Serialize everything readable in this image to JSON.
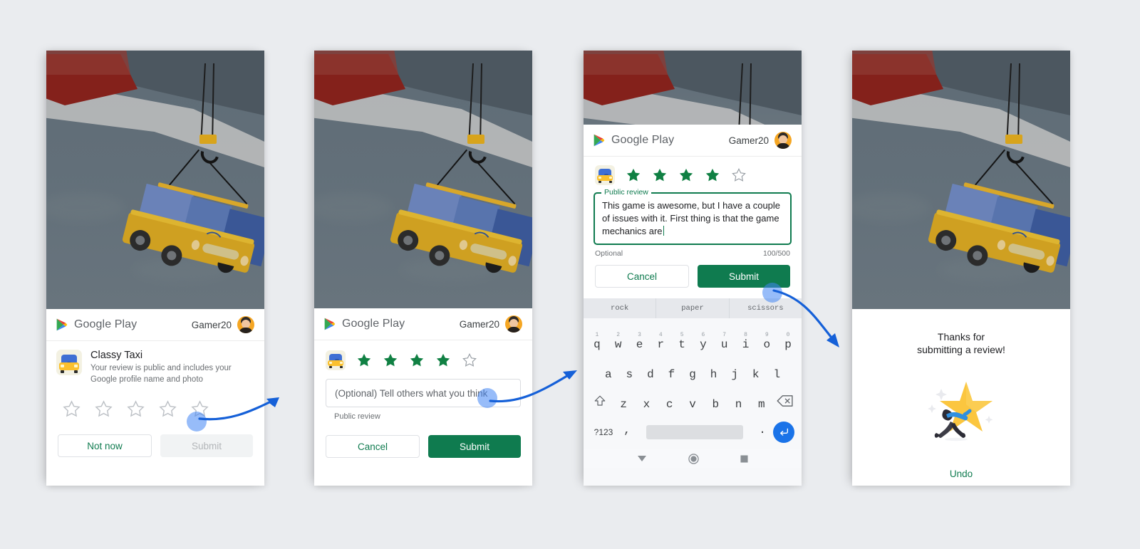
{
  "meta": {
    "page_bg": "#eaecef",
    "accent_green": "#0f7b4f",
    "accent_blue": "#1a73e8",
    "touch_blue": "#4285f4"
  },
  "panel1": {
    "app_bar": {
      "brand": "Google Play",
      "user": "Gamer20",
      "logo_icon": "google-play-icon",
      "avatar_icon": "user-avatar"
    },
    "app": {
      "name": "Classy Taxi",
      "description": "Your review is public and includes your Google profile name and photo",
      "icon": "classy-taxi-app-icon"
    },
    "rating": {
      "filled": 0,
      "total": 5,
      "star_icon": "star-outline-icon"
    },
    "buttons": {
      "secondary": "Not now",
      "primary": "Submit",
      "primary_disabled": true
    }
  },
  "panel2": {
    "app_bar": {
      "brand": "Google Play",
      "user": "Gamer20",
      "logo_icon": "google-play-icon",
      "avatar_icon": "user-avatar"
    },
    "rating": {
      "filled": 4,
      "total": 5,
      "app_icon": "classy-taxi-app-icon",
      "star_filled_icon": "star-filled-icon",
      "star_outline_icon": "star-outline-icon"
    },
    "review_field": {
      "placeholder": "(Optional) Tell others what you think",
      "value": "",
      "helper": "Public review"
    },
    "buttons": {
      "secondary": "Cancel",
      "primary": "Submit"
    }
  },
  "panel3": {
    "app_bar": {
      "brand": "Google Play",
      "user": "Gamer20",
      "logo_icon": "google-play-icon",
      "avatar_icon": "user-avatar"
    },
    "rating": {
      "filled": 4,
      "total": 5,
      "app_icon": "classy-taxi-app-icon"
    },
    "review_field": {
      "label": "Public review",
      "value": "This game is awesome, but I have a couple of issues with it. First thing is that the game mechanics are",
      "helper": "Optional",
      "counter": "100/500"
    },
    "buttons": {
      "secondary": "Cancel",
      "primary": "Submit"
    },
    "keyboard": {
      "suggestions": [
        "rock",
        "paper",
        "scissors"
      ],
      "row1": [
        {
          "key": "q",
          "num": "1"
        },
        {
          "key": "w",
          "num": "2"
        },
        {
          "key": "e",
          "num": "3"
        },
        {
          "key": "r",
          "num": "4"
        },
        {
          "key": "t",
          "num": "5"
        },
        {
          "key": "y",
          "num": "6"
        },
        {
          "key": "u",
          "num": "7"
        },
        {
          "key": "i",
          "num": "8"
        },
        {
          "key": "o",
          "num": "9"
        },
        {
          "key": "p",
          "num": "0"
        }
      ],
      "row2": [
        "a",
        "s",
        "d",
        "f",
        "g",
        "h",
        "j",
        "k",
        "l"
      ],
      "row3": [
        "z",
        "x",
        "c",
        "v",
        "b",
        "n",
        "m"
      ],
      "shift_icon": "shift-icon",
      "backspace_icon": "backspace-icon",
      "symbols_key": "?123",
      "comma_key": ",",
      "period_key": ".",
      "space_key": "",
      "enter_icon": "enter-icon",
      "navbar": {
        "back_icon": "nav-back-icon",
        "home_icon": "nav-home-icon",
        "recents_icon": "nav-recents-icon"
      }
    }
  },
  "panel4": {
    "title": "Thanks for\nsubmitting a review!",
    "illustration": "star-celebration-illustration",
    "undo": "Undo"
  },
  "annotations": {
    "arrows": [
      {
        "name": "arrow-step1-to-step2"
      },
      {
        "name": "arrow-step2-to-step3"
      },
      {
        "name": "arrow-step3-to-step4"
      }
    ],
    "touch_points": [
      {
        "name": "tap-4th-star"
      },
      {
        "name": "tap-review-field"
      },
      {
        "name": "tap-submit-button"
      }
    ]
  }
}
